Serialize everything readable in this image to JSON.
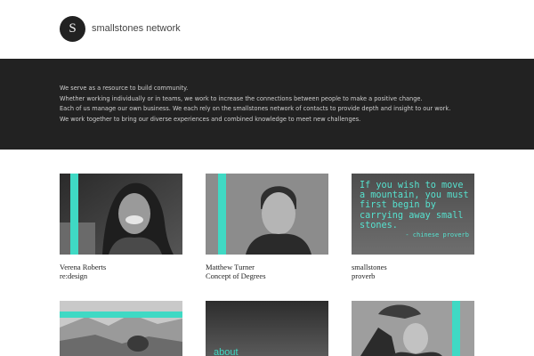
{
  "header": {
    "logo_letter": "S",
    "site_name": "smallstones network"
  },
  "banner": {
    "lines": [
      "We serve as a resource to build community.",
      "Whether working individually or in teams, we work to increase the connections between people to make a positive change.",
      "Each of us manage our own business. We each rely on the smallstones network of contacts to provide depth and insight to our work.",
      "We work together to bring our diverse experiences and combined knowledge to meet new challenges."
    ]
  },
  "cards": [
    {
      "name": "Verena Roberts",
      "subtitle": "re:design"
    },
    {
      "name": "Matthew Turner",
      "subtitle": "Concept of Degrees"
    },
    {
      "name": "smallstones",
      "subtitle": "proverb",
      "quote": "If you wish to move a mountain, you must first begin by carrying away small stones.",
      "quote_attr": "- chinese proverb"
    },
    {
      "about_label": "about"
    }
  ],
  "colors": {
    "accent": "#3fd9c4",
    "banner_bg": "#222222",
    "logo_bg": "#222222"
  }
}
